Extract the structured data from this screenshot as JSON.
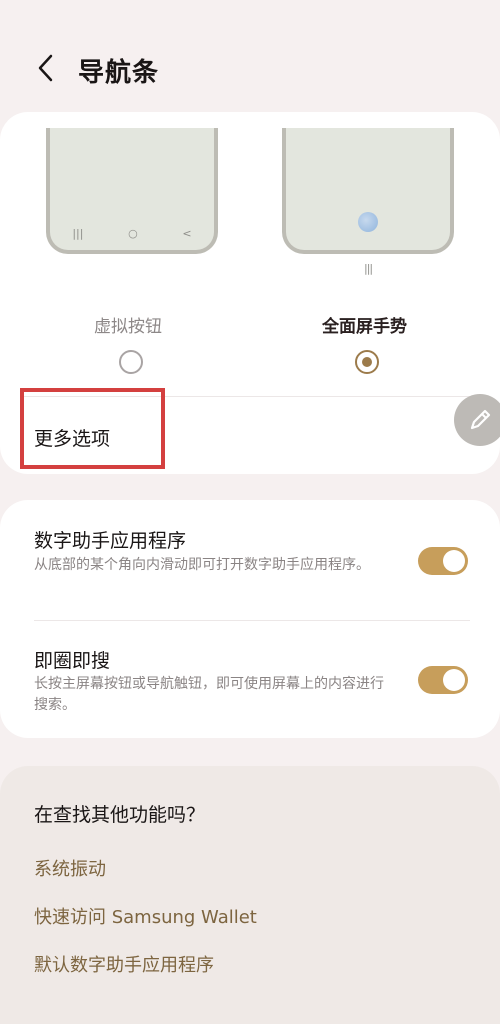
{
  "header": {
    "title": "导航条"
  },
  "nav_types": {
    "options": [
      {
        "label": "虚拟按钮",
        "selected": false
      },
      {
        "label": "全面屏手势",
        "selected": true
      }
    ],
    "virtual_buttons_icons": [
      "|||",
      "○",
      "<"
    ],
    "gesture_hint_icon": "|||"
  },
  "more_options": {
    "label": "更多选项"
  },
  "settings": [
    {
      "title": "数字助手应用程序",
      "description": "从底部的某个角向内滑动即可打开数字助手应用程序。",
      "enabled": true
    },
    {
      "title": "即圈即搜",
      "description": "长按主屏幕按钮或导航触钮，即可使用屏幕上的内容进行搜索。",
      "enabled": true
    }
  ],
  "find_more": {
    "title": "在查找其他功能吗？",
    "links": [
      "系统振动",
      "快速访问 Samsung Wallet",
      "默认数字助手应用程序"
    ]
  },
  "colors": {
    "accent": "#c79e5b",
    "highlight_box": "#d4403f",
    "link": "#7d6540"
  }
}
